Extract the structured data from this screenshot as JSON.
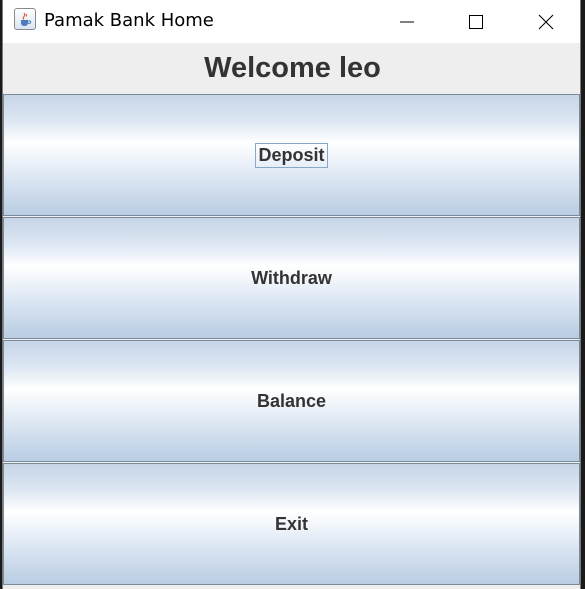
{
  "window": {
    "title": "Pamak Bank Home",
    "icon": "java-cup-icon"
  },
  "header": {
    "welcome_text": "Welcome leo"
  },
  "actions": {
    "deposit_label": "Deposit",
    "withdraw_label": "Withdraw",
    "balance_label": "Balance",
    "exit_label": "Exit"
  },
  "colors": {
    "button_gradient_top": "#c6d5e7",
    "button_gradient_mid": "#ffffff",
    "button_gradient_bottom": "#b9cde4",
    "text": "#333333"
  }
}
